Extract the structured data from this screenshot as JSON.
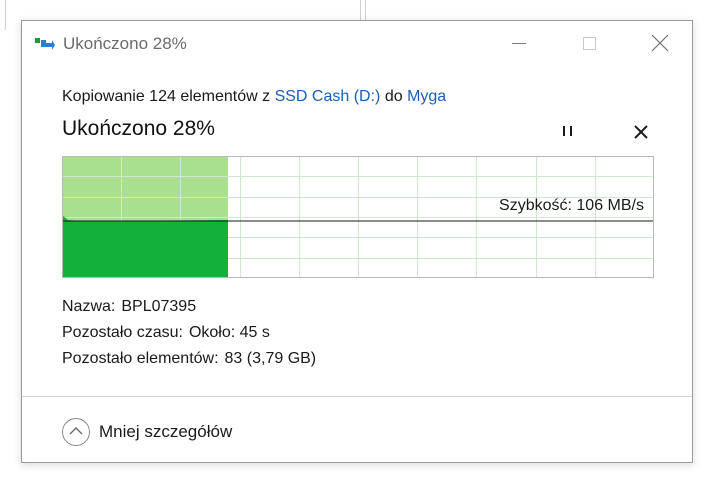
{
  "window": {
    "title": "Ukończono 28%"
  },
  "copy": {
    "prefix": "Kopiowanie 124 elementów z ",
    "source": "SSD Cash (D:)",
    "middle": " do ",
    "destination": "Myga"
  },
  "status": {
    "title": "Ukończono 28%",
    "progress_fraction": 0.28
  },
  "graph": {
    "speed_label": "Szybkość: 106 MB/s",
    "colors": {
      "done_fill": "#a8e08f",
      "speed_fill": "#13b13a",
      "grid": "#cfe8cf",
      "border": "#b8b8b8",
      "speed_line": "#1a1a1a"
    }
  },
  "details": {
    "name_label": "Nazwa:",
    "name_value": "BPL07395",
    "time_label": "Pozostało czasu:",
    "time_value": "Około: 45 s",
    "items_label": "Pozostało elementów:",
    "items_value": "83 (3,79 GB)"
  },
  "footer": {
    "less_details_label": "Mniej szczegółów"
  },
  "icons": {
    "app": "copy-files-icon",
    "minimize": "minimize-icon",
    "maximize": "maximize-icon",
    "close": "close-icon",
    "pause": "pause-icon",
    "stop": "stop-icon",
    "chevron": "chevron-up-icon"
  }
}
